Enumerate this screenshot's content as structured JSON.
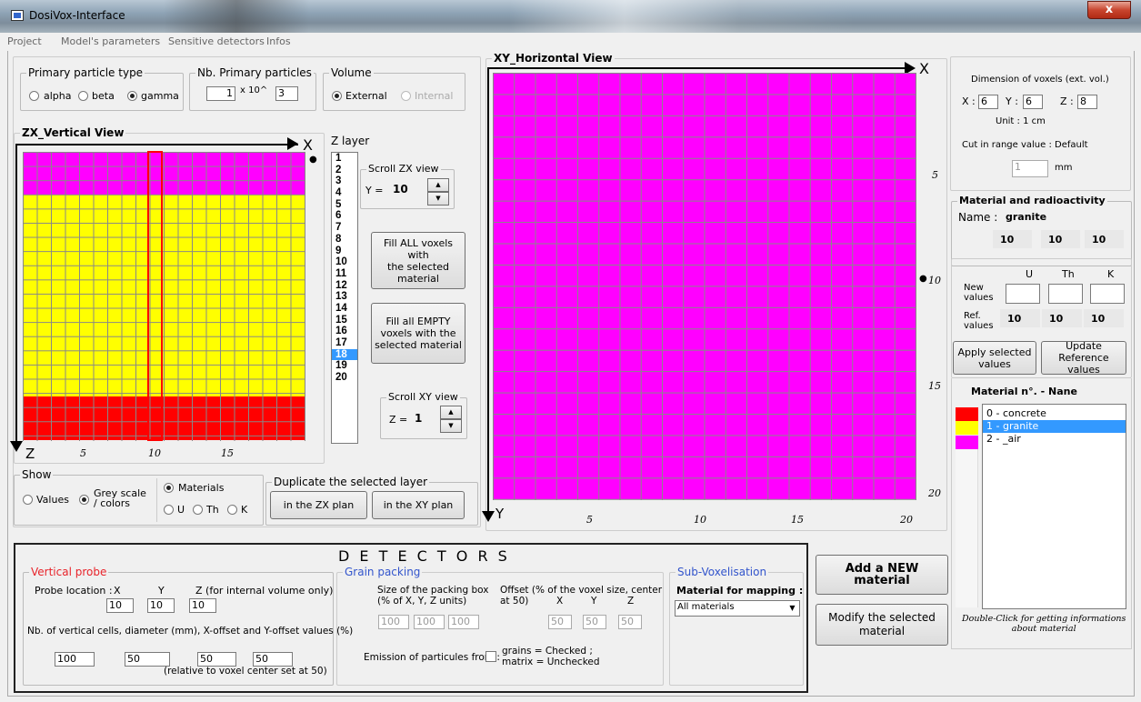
{
  "window": {
    "title": "DosiVox-Interface",
    "close": "x"
  },
  "menu": [
    "Project",
    "Model's parameters",
    "Sensitive detectors",
    "Infos"
  ],
  "primary": {
    "label": "Primary particle type",
    "alpha": "alpha",
    "beta": "beta",
    "gamma": "gamma"
  },
  "nbprimary": {
    "label": "Nb. Primary particles",
    "mantissa": "1",
    "times": "x 10^",
    "exponent": "3"
  },
  "volume": {
    "label": "Volume",
    "external": "External",
    "internal": "Internal"
  },
  "zx": {
    "title": "ZX_Vertical View",
    "x_axis": "X",
    "z_axis": "Z",
    "ticks": [
      "5",
      "10",
      "15"
    ],
    "dot": "●"
  },
  "zlayer": {
    "label": "Z layer",
    "items": [
      "1",
      "2",
      "3",
      "4",
      "5",
      "6",
      "7",
      "8",
      "9",
      "10",
      "11",
      "12",
      "13",
      "14",
      "15",
      "16",
      "17",
      "18",
      "19",
      "20"
    ],
    "selected": "18"
  },
  "scrollzx": {
    "label": "Scroll ZX view",
    "prefix": "Y =",
    "value": "10"
  },
  "scrollxy": {
    "label": "Scroll XY view",
    "prefix": "Z =",
    "value": "1"
  },
  "buttons": {
    "fill_all": "Fill  ALL voxels with\nthe selected material",
    "fill_empty": "Fill  all EMPTY\nvoxels with the\nselected material",
    "zx_plan": "in the ZX plan",
    "xy_plan": "in the XY plan",
    "add_material": "Add a NEW material",
    "modify_material": "Modify the selected\nmaterial",
    "apply": "Apply selected\nvalues",
    "update": "Update Reference\nvalues"
  },
  "show": {
    "label": "Show",
    "values": "Values",
    "grey": "Grey scale\n/ colors",
    "materials": "Materials",
    "u": "U",
    "th": "Th",
    "k": "K"
  },
  "duplicate": {
    "label": "Duplicate the selected layer"
  },
  "xy": {
    "title": "XY_Horizontal View",
    "x_axis": "X",
    "y_axis": "Y",
    "xticks": [
      "5",
      "10",
      "15",
      "20"
    ],
    "yticks": [
      "5",
      "10",
      "15",
      "20"
    ],
    "dot": "●"
  },
  "dimension": {
    "title": "Dimension of voxels (ext. vol.)",
    "x_label": "X :",
    "x": "6",
    "y_label": "Y :",
    "y": "6",
    "z_label": "Z :",
    "z": "8",
    "unit": "Unit :   1 cm",
    "cut": "Cut in range value :   Default",
    "cut_value": "1",
    "cut_unit": "mm"
  },
  "material": {
    "group": "Material and radioactivity",
    "name_label": "Name :",
    "name": "granite",
    "v1": "10",
    "v2": "10",
    "v3": "10",
    "U": "U",
    "Th": "Th",
    "K": "K",
    "new_values": "New\nvalues",
    "ref_values": "Ref.\nvalues",
    "ref_u": "10",
    "ref_th": "10",
    "ref_k": "10",
    "list_header": "Material  n°. -   Nane",
    "items": [
      "0 - concrete",
      "1 - granite",
      "2 - _air"
    ],
    "hint": "Double-Click for getting informations\nabout material"
  },
  "colors": {
    "concrete": "#ff0000",
    "granite": "#ffff00",
    "air": "#ff00ff"
  },
  "detectors": {
    "title": "D  E  T  E  C  T  O  R  S",
    "vertical_probe": "Vertical probe",
    "probe_location": "Probe location :",
    "x": "X",
    "y": "Y",
    "z": "Z  (for internal volume only)",
    "px": "10",
    "py": "10",
    "pz": "10",
    "nb_label": "Nb. of vertical cells, diameter (mm), X-offset and Y-offset values (%)",
    "n1": "100",
    "n2": "50",
    "n3": "50",
    "n4": "50",
    "relative": "(relative  to voxel  center set at 50)"
  },
  "grain": {
    "label": "Grain packing",
    "size_label": "Size of the packing box\n(% of X, Y, Z units)",
    "s1": "100",
    "s2": "100",
    "s3": "100",
    "offset_label": "Offset (% of the voxel size, center\nat 50)",
    "ox": "X",
    "oy": "Y",
    "oz": "Z",
    "o1": "50",
    "o2": "50",
    "o3": "50",
    "emission": "Emission of particules from :",
    "emission_opts": "grains = Checked ;\nmatrix = Unchecked"
  },
  "subvox": {
    "label": "Sub-Voxelisation",
    "mapping": "Material for mapping :",
    "select": "All materials"
  }
}
